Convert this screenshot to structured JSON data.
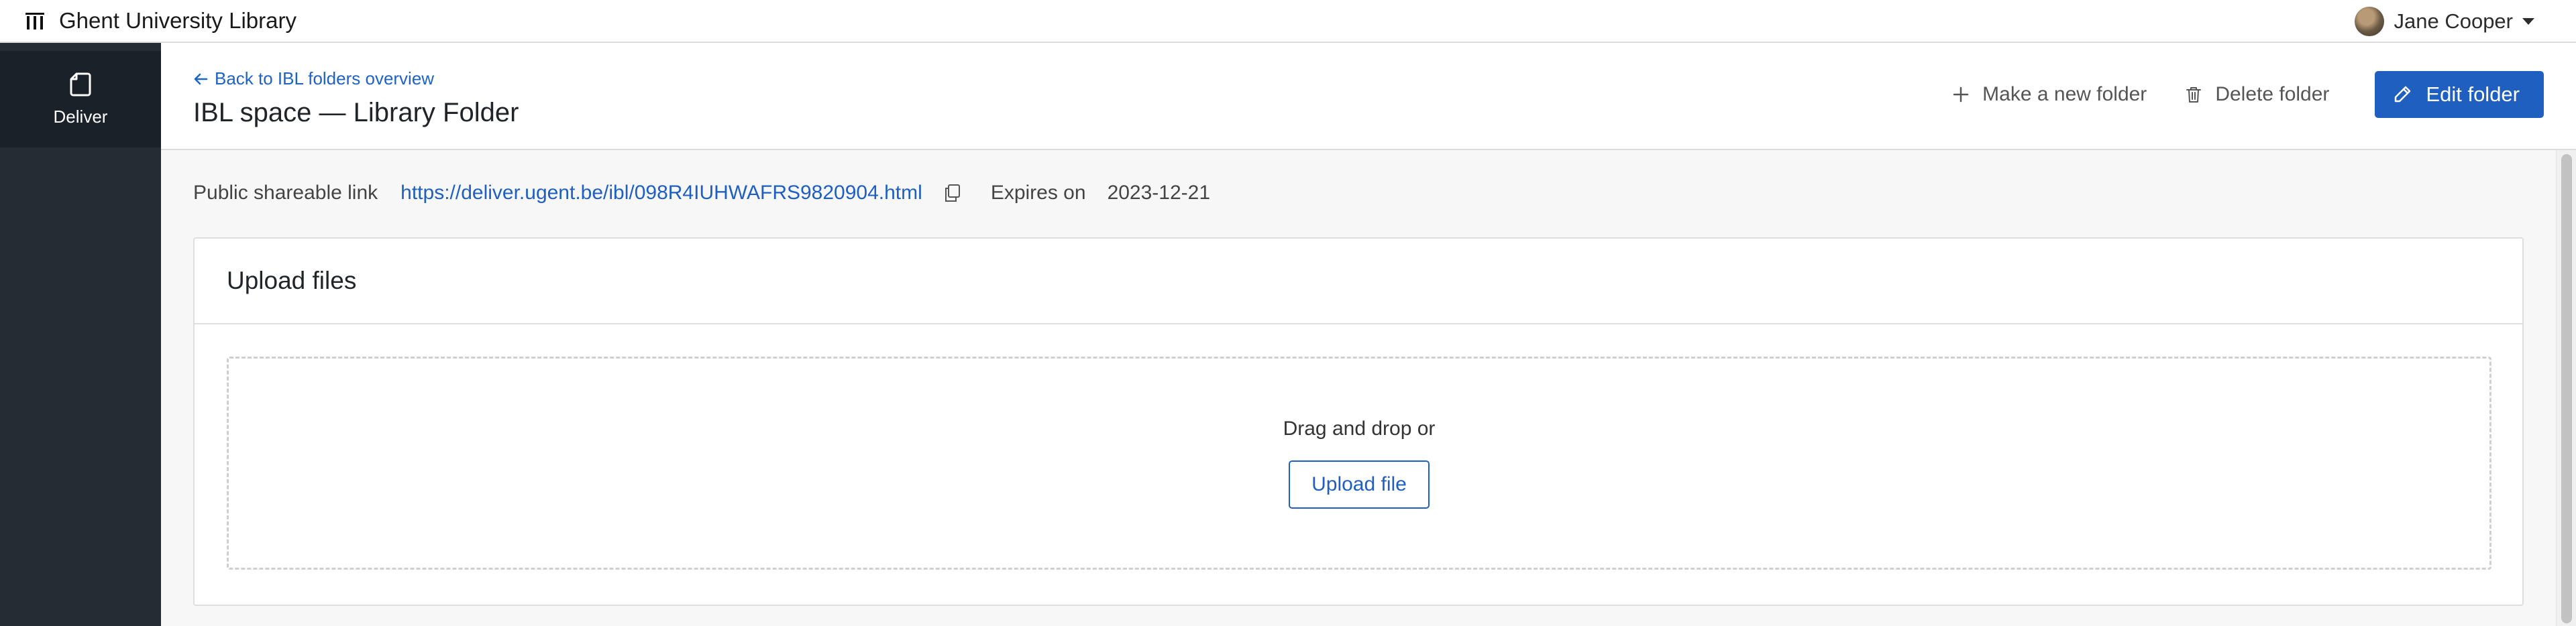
{
  "app": {
    "brand": "Ghent University Library"
  },
  "user": {
    "name": "Jane Cooper"
  },
  "sidebar": {
    "items": [
      {
        "label": "Deliver",
        "icon": "file-icon"
      }
    ]
  },
  "header": {
    "back_label": "Back to IBL folders overview",
    "title": "IBL space — Library Folder",
    "actions": {
      "new_folder": "Make a new folder",
      "delete_folder": "Delete folder",
      "edit_folder": "Edit folder"
    }
  },
  "share": {
    "label": "Public shareable link",
    "url": "https://deliver.ugent.be/ibl/098R4IUHWAFRS9820904.html",
    "expires_label": "Expires on",
    "expires_date": "2023-12-21"
  },
  "upload": {
    "title": "Upload files",
    "drop_text": "Drag and drop or",
    "button": "Upload file"
  },
  "colors": {
    "primary": "#1f5fbf",
    "sidebar": "#262c33",
    "sidebar_active": "#1b2128"
  }
}
